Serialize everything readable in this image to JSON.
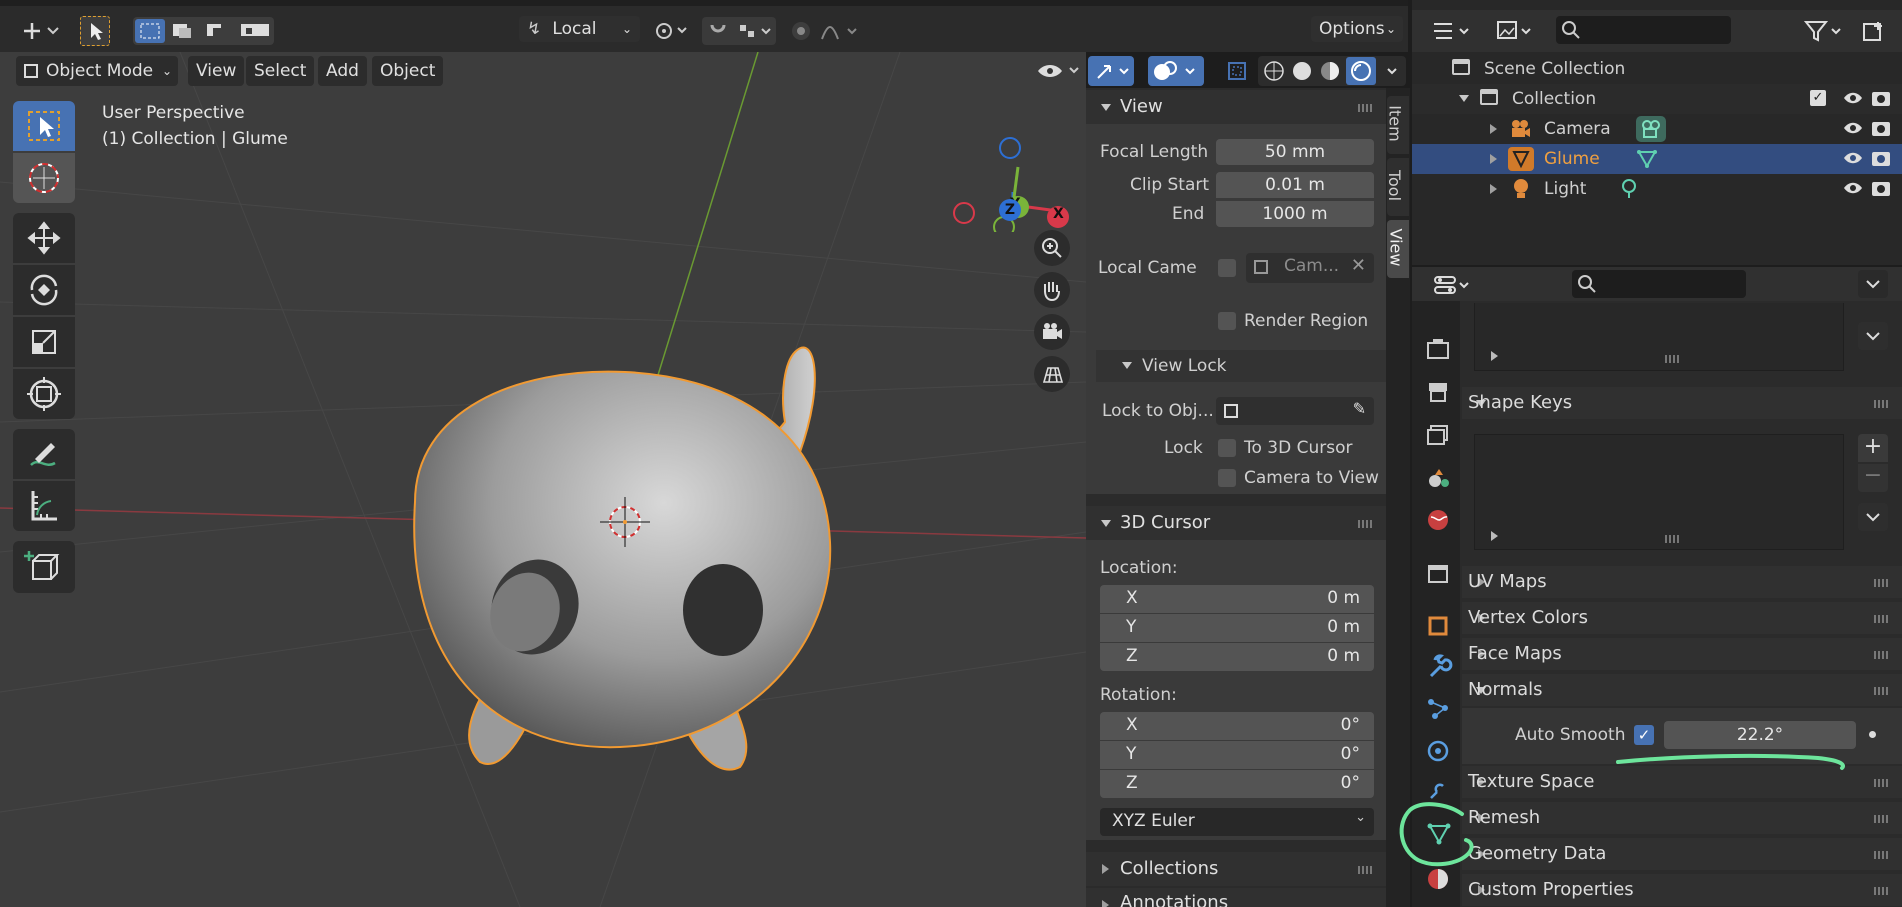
{
  "header": {
    "transform_orientation": "Local",
    "options_label": "Options"
  },
  "viewport_header": {
    "mode": "Object Mode",
    "menus": [
      "View",
      "Select",
      "Add",
      "Object"
    ]
  },
  "viewport": {
    "perspective_label": "User Perspective",
    "collection_label": "(1) Collection | Glume",
    "gizmo_axes": {
      "x": "X",
      "y": "Y",
      "z": "Z"
    }
  },
  "sidebar_tabs": [
    "Item",
    "Tool",
    "View"
  ],
  "view_panel": {
    "title": "View",
    "focal_length_label": "Focal Length",
    "focal_length": "50 mm",
    "clip_start_label": "Clip Start",
    "clip_start": "0.01 m",
    "end_label": "End",
    "end": "1000 m",
    "local_camera_label": "Local Came",
    "local_camera_value": "Cam...",
    "render_region_label": "Render Region",
    "view_lock_title": "View Lock",
    "lock_to_object_label": "Lock to Obj...",
    "lock_label": "Lock",
    "to_3d_cursor_label": "To 3D Cursor",
    "camera_to_view_label": "Camera to View"
  },
  "cursor_panel": {
    "title": "3D Cursor",
    "location_label": "Location:",
    "location": [
      {
        "axis": "X",
        "value": "0 m"
      },
      {
        "axis": "Y",
        "value": "0 m"
      },
      {
        "axis": "Z",
        "value": "0 m"
      }
    ],
    "rotation_label": "Rotation:",
    "rotation": [
      {
        "axis": "X",
        "value": "0°"
      },
      {
        "axis": "Y",
        "value": "0°"
      },
      {
        "axis": "Z",
        "value": "0°"
      }
    ],
    "rotation_mode": "XYZ Euler"
  },
  "collapsed_panels": [
    "Collections",
    "Annotations"
  ],
  "outliner": {
    "scene_collection": "Scene Collection",
    "collection": "Collection",
    "items": [
      {
        "name": "Camera",
        "selected": false
      },
      {
        "name": "Glume",
        "selected": true
      },
      {
        "name": "Light",
        "selected": false
      }
    ]
  },
  "properties": {
    "shape_keys": "Shape Keys",
    "uv_maps": "UV Maps",
    "vertex_colors": "Vertex Colors",
    "face_maps": "Face Maps",
    "normals": "Normals",
    "auto_smooth_label": "Auto Smooth",
    "auto_smooth_checked": true,
    "auto_smooth_angle": "22.2°",
    "texture_space": "Texture Space",
    "remesh": "Remesh",
    "geometry_data": "Geometry Data",
    "custom_properties": "Custom Properties"
  },
  "colors": {
    "accent_blue": "#4772b3",
    "selection_orange": "#f19a32",
    "annotation_green": "#6de59c",
    "selected_row": "#334d80"
  }
}
